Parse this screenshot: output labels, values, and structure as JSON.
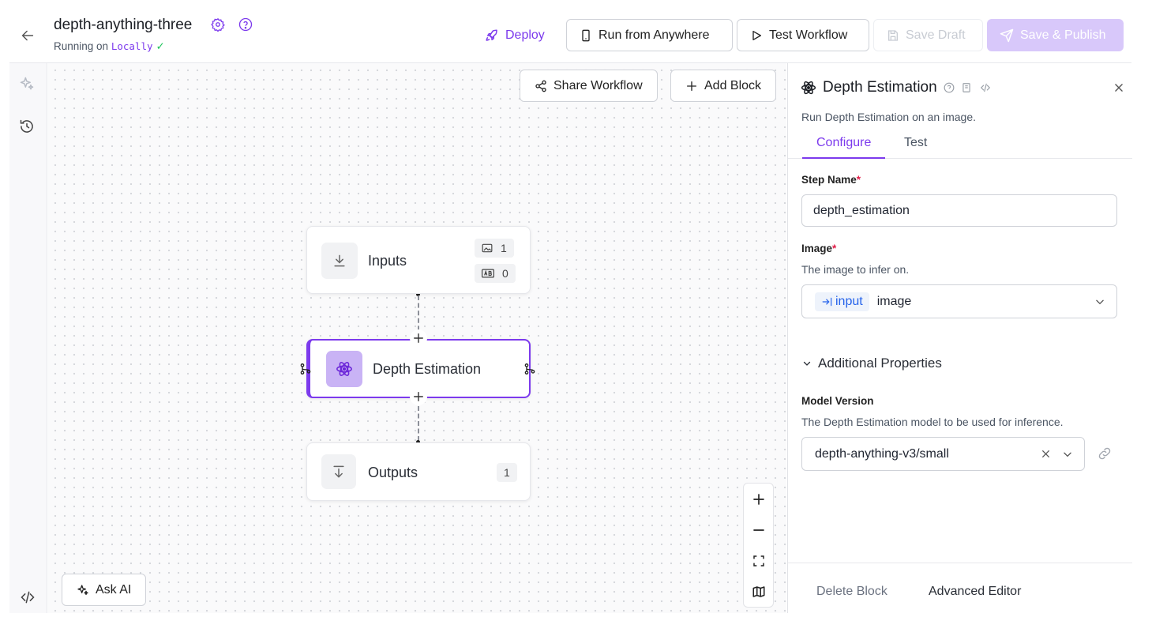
{
  "header": {
    "title": "depth-anything-three",
    "running_prefix": "Running on",
    "running_env": "Locally",
    "deploy_label": "Deploy",
    "run_anywhere_label": "Run from Anywhere",
    "test_workflow_label": "Test Workflow",
    "save_draft_label": "Save Draft",
    "save_publish_label": "Save & Publish"
  },
  "canvas": {
    "share_label": "Share Workflow",
    "add_block_label": "Add Block",
    "ask_ai_label": "Ask AI",
    "nodes": {
      "inputs": {
        "label": "Inputs",
        "image_count": "1",
        "text_count": "0"
      },
      "depth": {
        "label": "Depth Estimation"
      },
      "outputs": {
        "label": "Outputs",
        "count": "1"
      }
    }
  },
  "panel": {
    "title": "Depth Estimation",
    "description": "Run Depth Estimation on an image.",
    "tabs": [
      "Configure",
      "Test"
    ],
    "step_name": {
      "label": "Step Name",
      "required": "*",
      "value": "depth_estimation"
    },
    "image": {
      "label": "Image",
      "required": "*",
      "description": "The image to infer on.",
      "tag": "input",
      "value": "image"
    },
    "additional_label": "Additional Properties",
    "model_version": {
      "label": "Model Version",
      "description": "The Depth Estimation model to be used for inference.",
      "value": "depth-anything-v3/small"
    },
    "delete_label": "Delete Block",
    "advanced_label": "Advanced Editor"
  },
  "colors": {
    "accent": "#7c3aed",
    "accent_light": "#d8c8fa",
    "success": "#22c55e"
  }
}
